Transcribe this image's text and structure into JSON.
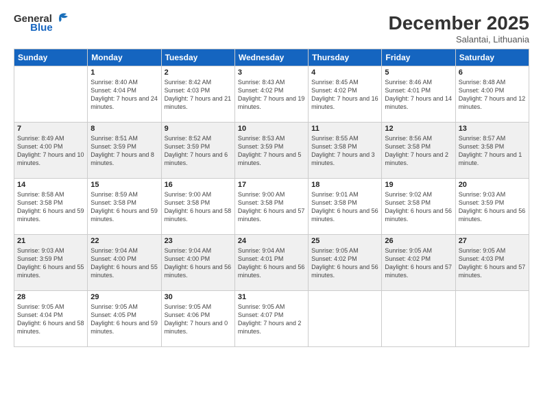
{
  "header": {
    "logo_general": "General",
    "logo_blue": "Blue",
    "month": "December 2025",
    "location": "Salantai, Lithuania"
  },
  "weekdays": [
    "Sunday",
    "Monday",
    "Tuesday",
    "Wednesday",
    "Thursday",
    "Friday",
    "Saturday"
  ],
  "weeks": [
    [
      {
        "day": "",
        "sunrise": "",
        "sunset": "",
        "daylight": ""
      },
      {
        "day": "1",
        "sunrise": "Sunrise: 8:40 AM",
        "sunset": "Sunset: 4:04 PM",
        "daylight": "Daylight: 7 hours and 24 minutes."
      },
      {
        "day": "2",
        "sunrise": "Sunrise: 8:42 AM",
        "sunset": "Sunset: 4:03 PM",
        "daylight": "Daylight: 7 hours and 21 minutes."
      },
      {
        "day": "3",
        "sunrise": "Sunrise: 8:43 AM",
        "sunset": "Sunset: 4:02 PM",
        "daylight": "Daylight: 7 hours and 19 minutes."
      },
      {
        "day": "4",
        "sunrise": "Sunrise: 8:45 AM",
        "sunset": "Sunset: 4:02 PM",
        "daylight": "Daylight: 7 hours and 16 minutes."
      },
      {
        "day": "5",
        "sunrise": "Sunrise: 8:46 AM",
        "sunset": "Sunset: 4:01 PM",
        "daylight": "Daylight: 7 hours and 14 minutes."
      },
      {
        "day": "6",
        "sunrise": "Sunrise: 8:48 AM",
        "sunset": "Sunset: 4:00 PM",
        "daylight": "Daylight: 7 hours and 12 minutes."
      }
    ],
    [
      {
        "day": "7",
        "sunrise": "Sunrise: 8:49 AM",
        "sunset": "Sunset: 4:00 PM",
        "daylight": "Daylight: 7 hours and 10 minutes."
      },
      {
        "day": "8",
        "sunrise": "Sunrise: 8:51 AM",
        "sunset": "Sunset: 3:59 PM",
        "daylight": "Daylight: 7 hours and 8 minutes."
      },
      {
        "day": "9",
        "sunrise": "Sunrise: 8:52 AM",
        "sunset": "Sunset: 3:59 PM",
        "daylight": "Daylight: 7 hours and 6 minutes."
      },
      {
        "day": "10",
        "sunrise": "Sunrise: 8:53 AM",
        "sunset": "Sunset: 3:59 PM",
        "daylight": "Daylight: 7 hours and 5 minutes."
      },
      {
        "day": "11",
        "sunrise": "Sunrise: 8:55 AM",
        "sunset": "Sunset: 3:58 PM",
        "daylight": "Daylight: 7 hours and 3 minutes."
      },
      {
        "day": "12",
        "sunrise": "Sunrise: 8:56 AM",
        "sunset": "Sunset: 3:58 PM",
        "daylight": "Daylight: 7 hours and 2 minutes."
      },
      {
        "day": "13",
        "sunrise": "Sunrise: 8:57 AM",
        "sunset": "Sunset: 3:58 PM",
        "daylight": "Daylight: 7 hours and 1 minute."
      }
    ],
    [
      {
        "day": "14",
        "sunrise": "Sunrise: 8:58 AM",
        "sunset": "Sunset: 3:58 PM",
        "daylight": "Daylight: 6 hours and 59 minutes."
      },
      {
        "day": "15",
        "sunrise": "Sunrise: 8:59 AM",
        "sunset": "Sunset: 3:58 PM",
        "daylight": "Daylight: 6 hours and 59 minutes."
      },
      {
        "day": "16",
        "sunrise": "Sunrise: 9:00 AM",
        "sunset": "Sunset: 3:58 PM",
        "daylight": "Daylight: 6 hours and 58 minutes."
      },
      {
        "day": "17",
        "sunrise": "Sunrise: 9:00 AM",
        "sunset": "Sunset: 3:58 PM",
        "daylight": "Daylight: 6 hours and 57 minutes."
      },
      {
        "day": "18",
        "sunrise": "Sunrise: 9:01 AM",
        "sunset": "Sunset: 3:58 PM",
        "daylight": "Daylight: 6 hours and 56 minutes."
      },
      {
        "day": "19",
        "sunrise": "Sunrise: 9:02 AM",
        "sunset": "Sunset: 3:58 PM",
        "daylight": "Daylight: 6 hours and 56 minutes."
      },
      {
        "day": "20",
        "sunrise": "Sunrise: 9:03 AM",
        "sunset": "Sunset: 3:59 PM",
        "daylight": "Daylight: 6 hours and 56 minutes."
      }
    ],
    [
      {
        "day": "21",
        "sunrise": "Sunrise: 9:03 AM",
        "sunset": "Sunset: 3:59 PM",
        "daylight": "Daylight: 6 hours and 55 minutes."
      },
      {
        "day": "22",
        "sunrise": "Sunrise: 9:04 AM",
        "sunset": "Sunset: 4:00 PM",
        "daylight": "Daylight: 6 hours and 55 minutes."
      },
      {
        "day": "23",
        "sunrise": "Sunrise: 9:04 AM",
        "sunset": "Sunset: 4:00 PM",
        "daylight": "Daylight: 6 hours and 56 minutes."
      },
      {
        "day": "24",
        "sunrise": "Sunrise: 9:04 AM",
        "sunset": "Sunset: 4:01 PM",
        "daylight": "Daylight: 6 hours and 56 minutes."
      },
      {
        "day": "25",
        "sunrise": "Sunrise: 9:05 AM",
        "sunset": "Sunset: 4:02 PM",
        "daylight": "Daylight: 6 hours and 56 minutes."
      },
      {
        "day": "26",
        "sunrise": "Sunrise: 9:05 AM",
        "sunset": "Sunset: 4:02 PM",
        "daylight": "Daylight: 6 hours and 57 minutes."
      },
      {
        "day": "27",
        "sunrise": "Sunrise: 9:05 AM",
        "sunset": "Sunset: 4:03 PM",
        "daylight": "Daylight: 6 hours and 57 minutes."
      }
    ],
    [
      {
        "day": "28",
        "sunrise": "Sunrise: 9:05 AM",
        "sunset": "Sunset: 4:04 PM",
        "daylight": "Daylight: 6 hours and 58 minutes."
      },
      {
        "day": "29",
        "sunrise": "Sunrise: 9:05 AM",
        "sunset": "Sunset: 4:05 PM",
        "daylight": "Daylight: 6 hours and 59 minutes."
      },
      {
        "day": "30",
        "sunrise": "Sunrise: 9:05 AM",
        "sunset": "Sunset: 4:06 PM",
        "daylight": "Daylight: 7 hours and 0 minutes."
      },
      {
        "day": "31",
        "sunrise": "Sunrise: 9:05 AM",
        "sunset": "Sunset: 4:07 PM",
        "daylight": "Daylight: 7 hours and 2 minutes."
      },
      {
        "day": "",
        "sunrise": "",
        "sunset": "",
        "daylight": ""
      },
      {
        "day": "",
        "sunrise": "",
        "sunset": "",
        "daylight": ""
      },
      {
        "day": "",
        "sunrise": "",
        "sunset": "",
        "daylight": ""
      }
    ]
  ]
}
